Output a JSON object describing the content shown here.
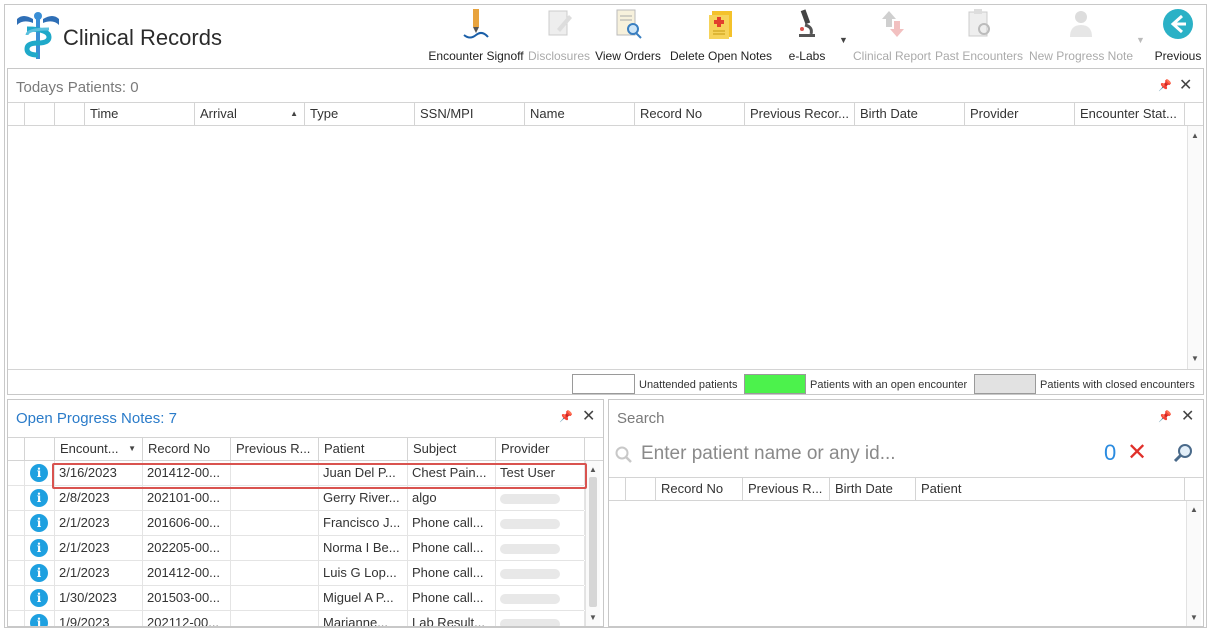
{
  "app": {
    "title": "Clinical Records"
  },
  "toolbar": [
    {
      "id": "encounter-signoff",
      "label": "Encounter Signoff",
      "icon": "signature-pen-icon",
      "disabled": false
    },
    {
      "id": "disclosures",
      "label": "Disclosures",
      "icon": "document-edit-icon",
      "disabled": true
    },
    {
      "id": "view-orders",
      "label": "View Orders",
      "icon": "document-magnifier-icon",
      "disabled": false
    },
    {
      "id": "delete-open-notes",
      "label": "Delete Open Notes",
      "icon": "medical-notes-icon",
      "disabled": false
    },
    {
      "id": "e-labs",
      "label": "e-Labs",
      "icon": "microscope-icon",
      "disabled": false
    },
    {
      "id": "clinical-report",
      "label": "Clinical Report",
      "icon": "report-arrows-icon",
      "disabled": true
    },
    {
      "id": "past-encounters",
      "label": "Past Encounters",
      "icon": "clipboard-search-icon",
      "disabled": true
    },
    {
      "id": "new-progress-note",
      "label": "New Progress Note",
      "icon": "user-note-icon",
      "disabled": true
    },
    {
      "id": "previous",
      "label": "Previous",
      "icon": "arrow-left-circle-icon",
      "disabled": false
    }
  ],
  "todays": {
    "title": "Todays Patients:",
    "count": "0",
    "columns": [
      "Time",
      "Arrival",
      "Type",
      "SSN/MPI",
      "Name",
      "Record No",
      "Previous Recor...",
      "Birth Date",
      "Provider",
      "Encounter Stat..."
    ],
    "legend": [
      {
        "label": "Unattended patients",
        "color": "#ffffff"
      },
      {
        "label": "Patients with an open encounter",
        "color": "#4cf24c"
      },
      {
        "label": "Patients with closed encounters",
        "color": "#e2e2e2"
      }
    ]
  },
  "notes": {
    "title": "Open Progress Notes:",
    "count": "7",
    "columns": [
      "Encount...",
      "Record No",
      "Previous R...",
      "Patient",
      "Subject",
      "Provider"
    ],
    "rows": [
      {
        "date": "3/16/2023",
        "record": "201412-00...",
        "previous": "",
        "patient": "Juan Del P...",
        "subject": "Chest Pain...",
        "provider": "Test User"
      },
      {
        "date": "2/8/2023",
        "record": "202101-00...",
        "previous": "",
        "patient": "Gerry River...",
        "subject": "algo",
        "provider": ""
      },
      {
        "date": "2/1/2023",
        "record": "201606-00...",
        "previous": "",
        "patient": "Francisco J...",
        "subject": "Phone call...",
        "provider": ""
      },
      {
        "date": "2/1/2023",
        "record": "202205-00...",
        "previous": "",
        "patient": "Norma I Be...",
        "subject": "Phone call...",
        "provider": ""
      },
      {
        "date": "2/1/2023",
        "record": "201412-00...",
        "previous": "",
        "patient": "Luis G Lop...",
        "subject": "Phone call...",
        "provider": ""
      },
      {
        "date": "1/30/2023",
        "record": "201503-00...",
        "previous": "",
        "patient": "Miguel A P...",
        "subject": "Phone call...",
        "provider": ""
      },
      {
        "date": "1/9/2023",
        "record": "202112-00...",
        "previous": "",
        "patient": "Marianne...",
        "subject": "Lab Result...",
        "provider": ""
      }
    ]
  },
  "search": {
    "title": "Search",
    "placeholder": "Enter patient name or any id...",
    "count": "0",
    "columns": [
      "Record No",
      "Previous R...",
      "Birth Date",
      "Patient"
    ]
  },
  "colors": {
    "accent": "#2a7bc9",
    "highlight": "#d9534f",
    "info": "#1ea0e0"
  }
}
